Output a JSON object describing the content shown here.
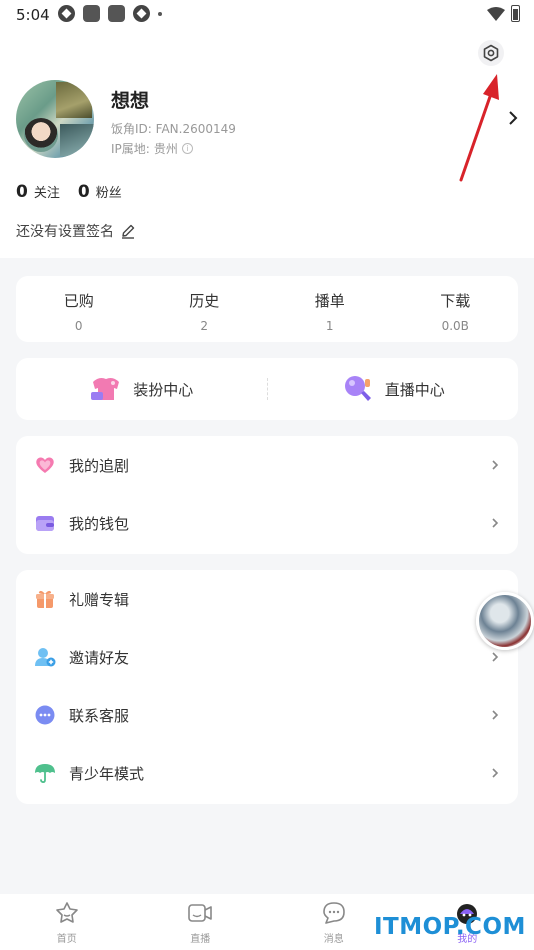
{
  "status_bar": {
    "time": "5:04"
  },
  "profile": {
    "username": "想想",
    "uid_label": "饭角ID:",
    "uid_value": "FAN.2600149",
    "ip_label": "IP属地:",
    "ip_value": "贵州",
    "following_count": "0",
    "following_label": "关注",
    "followers_count": "0",
    "followers_label": "粉丝",
    "signature": "还没有设置签名"
  },
  "summary": [
    {
      "label": "已购",
      "value": "0"
    },
    {
      "label": "历史",
      "value": "2"
    },
    {
      "label": "播单",
      "value": "1"
    },
    {
      "label": "下载",
      "value": "0.0B"
    }
  ],
  "centers": [
    {
      "label": "装扮中心",
      "icon": "dress-up-icon"
    },
    {
      "label": "直播中心",
      "icon": "live-mic-icon"
    }
  ],
  "menu_group_1": [
    {
      "label": "我的追剧",
      "icon": "heart-icon",
      "color": "#f57ab0"
    },
    {
      "label": "我的钱包",
      "icon": "wallet-icon",
      "color": "#9a7cf0"
    }
  ],
  "menu_group_2": [
    {
      "label": "礼赠专辑",
      "icon": "gift-icon",
      "color": "#f5996a"
    },
    {
      "label": "邀请好友",
      "icon": "invite-friend-icon",
      "color": "#5ab3f0"
    },
    {
      "label": "联系客服",
      "icon": "customer-service-icon",
      "color": "#7b8cf2"
    },
    {
      "label": "青少年模式",
      "icon": "umbrella-icon",
      "color": "#4fc08d"
    }
  ],
  "bottom_nav": [
    {
      "label": "首页",
      "icon": "home-icon",
      "active": false
    },
    {
      "label": "直播",
      "icon": "live-camera-icon",
      "active": false
    },
    {
      "label": "消息",
      "icon": "message-icon",
      "active": false
    },
    {
      "label": "我的",
      "icon": "profile-icon",
      "active": true
    }
  ],
  "watermark": "ITMOP.COM",
  "colors": {
    "accent": "#8a62f5",
    "annotation_arrow": "#d8232a"
  }
}
